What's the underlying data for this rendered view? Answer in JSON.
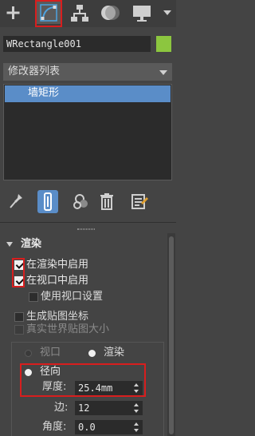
{
  "toolbar": {
    "tabs": [
      {
        "icon": "create-plus-icon"
      },
      {
        "icon": "modify-curve-icon",
        "active": true
      },
      {
        "icon": "hierarchy-icon"
      },
      {
        "icon": "motion-circle-icon"
      },
      {
        "icon": "display-monitor-icon"
      },
      {
        "icon": "more-chevron-icon"
      }
    ]
  },
  "object": {
    "name": "WRectangle001",
    "color": "#8cc63f"
  },
  "modifier_list": {
    "label": "修改器列表"
  },
  "stack": {
    "items": [
      "墙矩形"
    ],
    "selected_color": "#5a8dc8"
  },
  "stack_tools": {
    "icons": [
      "pin-stack-icon",
      "show-end-result-icon",
      "make-unique-icon",
      "remove-modifier-icon",
      "configure-modifier-sets-icon"
    ]
  },
  "rollout": {
    "title": "渲染",
    "enable_in_renderer": {
      "label": "在渲染中启用",
      "checked": true
    },
    "enable_in_viewport": {
      "label": "在视口中启用",
      "checked": true
    },
    "use_viewport_settings": {
      "label": "使用视口设置",
      "checked": false
    },
    "generate_mapping_coords": {
      "label": "生成贴图坐标",
      "checked": false
    },
    "real_world_map_size": {
      "label": "真实世界贴图大小",
      "checked": false
    },
    "mode": {
      "viewport_label": "视口",
      "render_label": "渲染",
      "selected": "render"
    },
    "radial": {
      "label": "径向",
      "selected": true
    },
    "thickness": {
      "label": "厚度:",
      "value": "25.4mm"
    },
    "sides": {
      "label": "边:",
      "value": "12"
    },
    "angle": {
      "label": "角度:",
      "value": "0.0"
    }
  },
  "colors": {
    "highlight": "#d81e1e",
    "accent": "#4da3e0",
    "panel": "#444444"
  }
}
